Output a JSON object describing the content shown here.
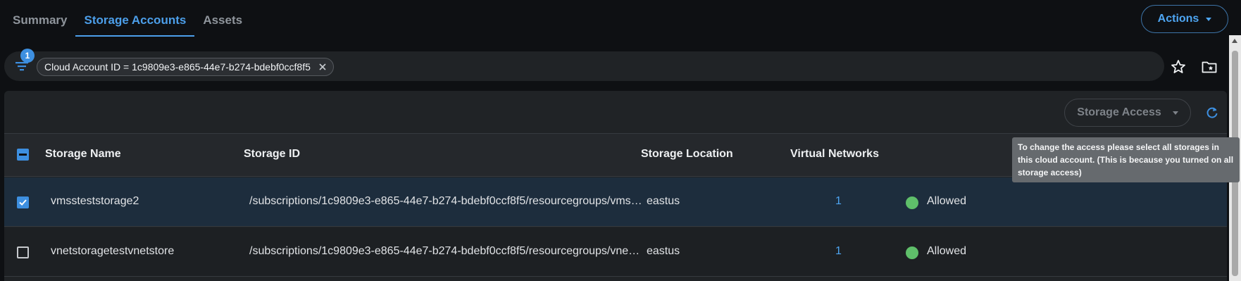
{
  "tabs": [
    {
      "label": "Summary",
      "active": false
    },
    {
      "label": "Storage Accounts",
      "active": true
    },
    {
      "label": "Assets",
      "active": false
    }
  ],
  "actions": {
    "label": "Actions"
  },
  "filter": {
    "badge_count": "1",
    "chip_label": "Cloud Account ID = 1c9809e3-e865-44e7-b274-bdebf0ccf8f5"
  },
  "toolbar": {
    "storage_access_label": "Storage Access"
  },
  "tooltip": {
    "text": "To change the access please select all storages in this cloud account. (This is because you turned on all storage access)"
  },
  "table": {
    "headers": {
      "name": "Storage Name",
      "id": "Storage ID",
      "location": "Storage Location",
      "vnets": "Virtual Networks"
    },
    "rows": [
      {
        "selected": true,
        "name": "vmssteststorage2",
        "id": "/subscriptions/1c9809e3-e865-44e7-b274-bdebf0ccf8f5/resourcegroups/vms…",
        "location": "eastus",
        "vnets": "1",
        "access": "Allowed"
      },
      {
        "selected": false,
        "name": "vnetstoragetestvnetstore",
        "id": "/subscriptions/1c9809e3-e865-44e7-b274-bdebf0ccf8f5/resourcegroups/vne…",
        "location": "eastus",
        "vnets": "1",
        "access": "Allowed"
      }
    ]
  },
  "colors": {
    "accent": "#4c9fea",
    "status_allowed": "#5fbf6a",
    "background": "#0e1013",
    "panel": "#202326"
  },
  "icons": [
    "filter-icon",
    "close-icon",
    "star-icon",
    "folder-star-icon",
    "refresh-icon",
    "chevron-down-icon",
    "checkbox-icon"
  ]
}
